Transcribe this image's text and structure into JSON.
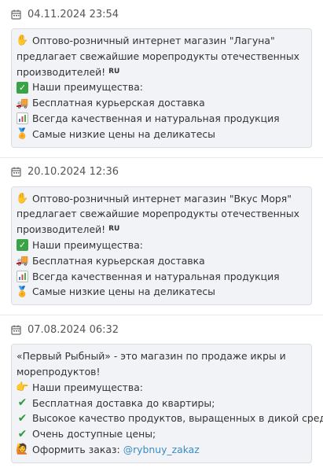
{
  "posts": [
    {
      "date": "04.11.2024 23:54",
      "intro_line1": "Оптово-розничный интернет магазин \"Лагуна\"",
      "intro_line2": "предлагает свежайшие морепродукты отечественных",
      "intro_line3": "производителей!",
      "flag": "RU",
      "items": [
        {
          "icon": "check-mark-button-icon",
          "text": "Наши преимущества:"
        },
        {
          "icon": "delivery-truck-icon",
          "text": "Бесплатная курьерская доставка"
        },
        {
          "icon": "bar-chart-icon",
          "text": "Всегда качественная и натуральная продукция"
        },
        {
          "icon": "medal-icon",
          "text": "Самые низкие цены на деликатесы"
        }
      ]
    },
    {
      "date": "20.10.2024 12:36",
      "intro_line1": "Оптово-розничный интернет магазин \"Вкус Моря\"",
      "intro_line2": "предлагает свежайшие морепродукты отечественных",
      "intro_line3": "производителей!",
      "flag": "RU",
      "items": [
        {
          "icon": "check-mark-button-icon",
          "text": "Наши преимущества:"
        },
        {
          "icon": "delivery-truck-icon",
          "text": "Бесплатная курьерская доставка"
        },
        {
          "icon": "bar-chart-icon",
          "text": "Всегда качественная и натуральная продукция"
        },
        {
          "icon": "medal-icon",
          "text": "Самые низкие цены на деликатесы"
        }
      ]
    },
    {
      "date": "07.08.2024 06:32",
      "intro_line1": "«Первый Рыбный» - это магазин по продаже икры и",
      "intro_line2": "морепродуктов!",
      "items": [
        {
          "icon": "pointing-hand-icon",
          "text": "Наши преимущества:"
        },
        {
          "icon": "check-mark-icon",
          "text": "Бесплатная доставка до квартиры;"
        },
        {
          "icon": "check-mark-icon",
          "text": "Высокое качество продуктов, выращенных в дикой среде;"
        },
        {
          "icon": "check-mark-icon",
          "text": "Очень доступные цены;"
        }
      ],
      "order_label": "Оформить заказ:",
      "order_link": "@rybnuy_zakaz"
    }
  ]
}
